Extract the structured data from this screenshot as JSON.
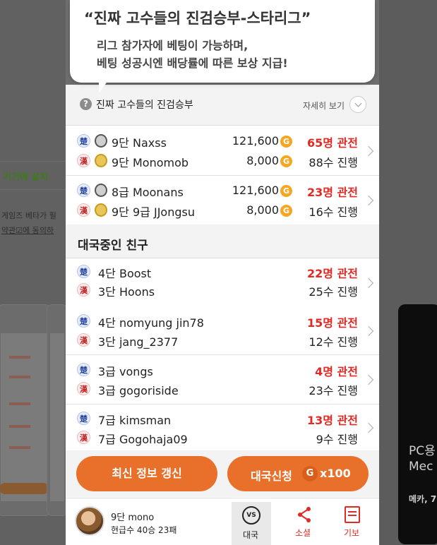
{
  "tooltip": {
    "title": "“진짜 고수들의 진검승부-스타리그”",
    "line1": "리그 참가자에 베팅이 가능하며,",
    "line2": "베팅 성공시엔 배당률에 따른 보상 지급!"
  },
  "info": {
    "title": "진짜 고수들의 진검승부",
    "more": "자세히 보기"
  },
  "matches": [
    {
      "p1": {
        "badge": "楚",
        "name": "9단 Naxss",
        "bet": "121,600"
      },
      "p2": {
        "badge": "漢",
        "name": "9단 Monomob",
        "bet": "8,000"
      },
      "watchers": "65명 관전",
      "moves": "88수 진행"
    },
    {
      "p1": {
        "badge": "楚",
        "name": "8급 Moonans",
        "bet": "121,600"
      },
      "p2": {
        "badge": "漢",
        "name": "9단 9급 JJongsu",
        "bet": "8,000"
      },
      "watchers": "23명 관전",
      "moves": "16수 진행"
    }
  ],
  "coin_symbol": "G",
  "friends_section": {
    "title": "대국중인 친구"
  },
  "friends": [
    {
      "p1": "4단 Boost",
      "p2": "3단 Hoons",
      "watchers": "22명 관전",
      "moves": "25수 진행",
      "b1": "楚",
      "b2": "漢"
    },
    {
      "p1": "4단 nomyung jin78",
      "p2": "3단 jang_2377",
      "watchers": "15명 관전",
      "moves": "12수 진행",
      "b1": "楚",
      "b2": "漢"
    },
    {
      "p1": "3급 vongs",
      "p2": "3급 gogoriside",
      "watchers": "4명 관전",
      "moves": "23수 진행",
      "b1": "楚",
      "b2": "漢"
    },
    {
      "p1": "7급 kimsman",
      "p2": "7급 Gogohaja09",
      "watchers": "13명 관전",
      "moves": "9수 진행",
      "b1": "楚",
      "b2": "漢"
    }
  ],
  "actions": {
    "refresh": "최신 정보 갱신",
    "apply": "대국신청",
    "apply_coin": "G",
    "apply_count": "x100"
  },
  "me": {
    "name": "9단 mono",
    "record": "현급수 40승 23패"
  },
  "tabs": {
    "vs_icon": "VS",
    "match": "대국",
    "social": "소셜",
    "record": "기보"
  },
  "background": {
    "install": "기기에 설치",
    "text1": "게임즈 베타가 필",
    "text2": "약관☑에 동의하",
    "pc": "PC용",
    "pc2": "Mec",
    "sub": "메카, 7"
  },
  "colors": {
    "accent": "#e8702a",
    "red": "#e02a24",
    "overlay": "#5c5c5c"
  }
}
